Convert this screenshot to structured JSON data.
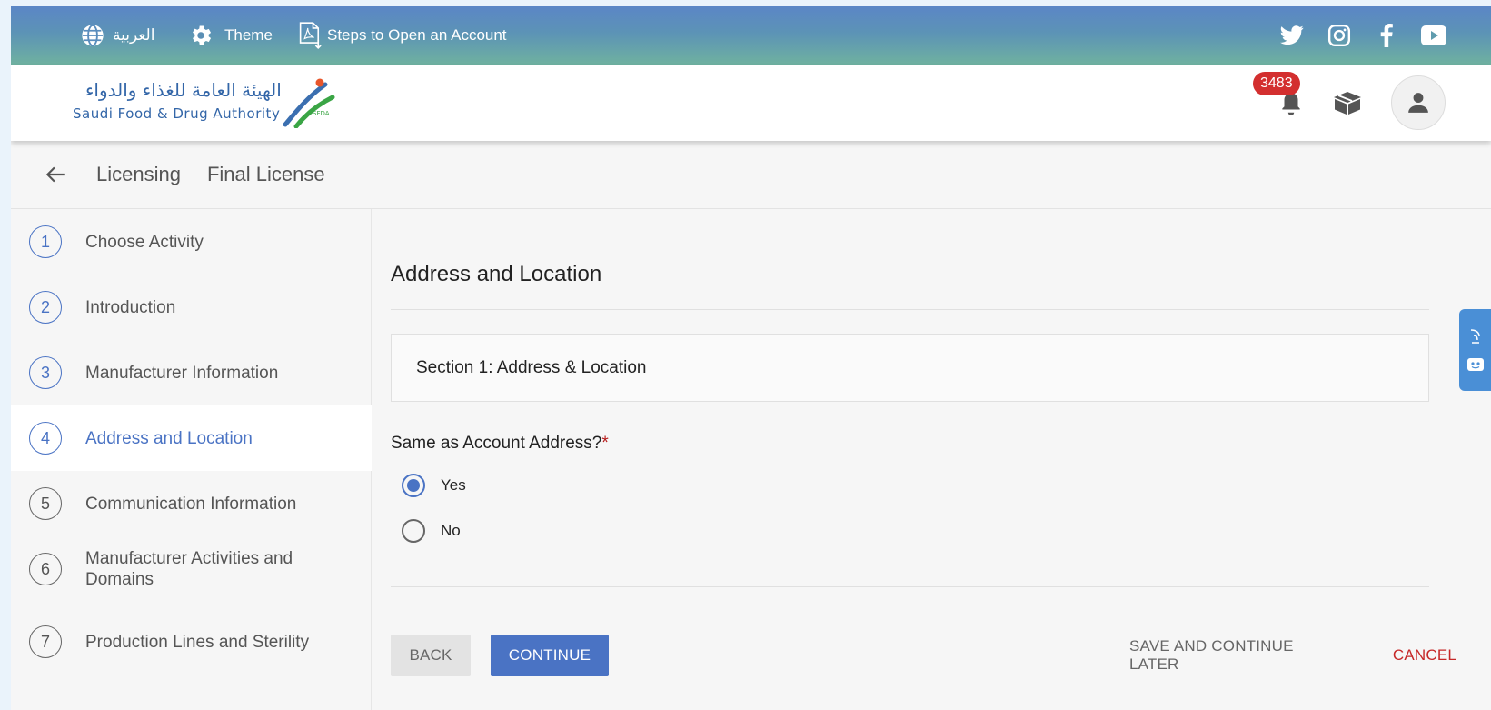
{
  "topbar": {
    "language_label": "العربية",
    "theme_label": "Theme",
    "steps_label": "Steps to Open an Account",
    "social_icons": [
      "twitter-icon",
      "instagram-icon",
      "facebook-icon",
      "youtube-icon"
    ]
  },
  "header": {
    "logo_arabic": "الهيئة العامة للغذاء والدواء",
    "logo_english": "Saudi Food & Drug Authority",
    "logo_badge": "SFDA",
    "notification_count": "3483"
  },
  "breadcrumb": {
    "section": "Licensing",
    "page": "Final License"
  },
  "sidebar": {
    "steps": [
      {
        "number": "1",
        "label": "Choose Activity"
      },
      {
        "number": "2",
        "label": "Introduction"
      },
      {
        "number": "3",
        "label": "Manufacturer Information"
      },
      {
        "number": "4",
        "label": "Address and Location"
      },
      {
        "number": "5",
        "label": "Communication Information"
      },
      {
        "number": "6",
        "label": "Manufacturer Activities and Domains"
      },
      {
        "number": "7",
        "label": "Production Lines and Sterility"
      }
    ],
    "active_step": "4"
  },
  "main": {
    "title": "Address and Location",
    "section_title": "Section 1: Address & Location",
    "question": "Same as Account Address?",
    "required_mark": "*",
    "options": [
      {
        "label": "Yes",
        "selected": true
      },
      {
        "label": "No",
        "selected": false
      }
    ]
  },
  "actions": {
    "back": "BACK",
    "continue": "CONTINUE",
    "save_later": "SAVE AND CONTINUE LATER",
    "cancel": "CANCEL"
  },
  "colors": {
    "accent": "#4a73c4",
    "cancel": "#c62828",
    "badge": "#d32f2f"
  }
}
